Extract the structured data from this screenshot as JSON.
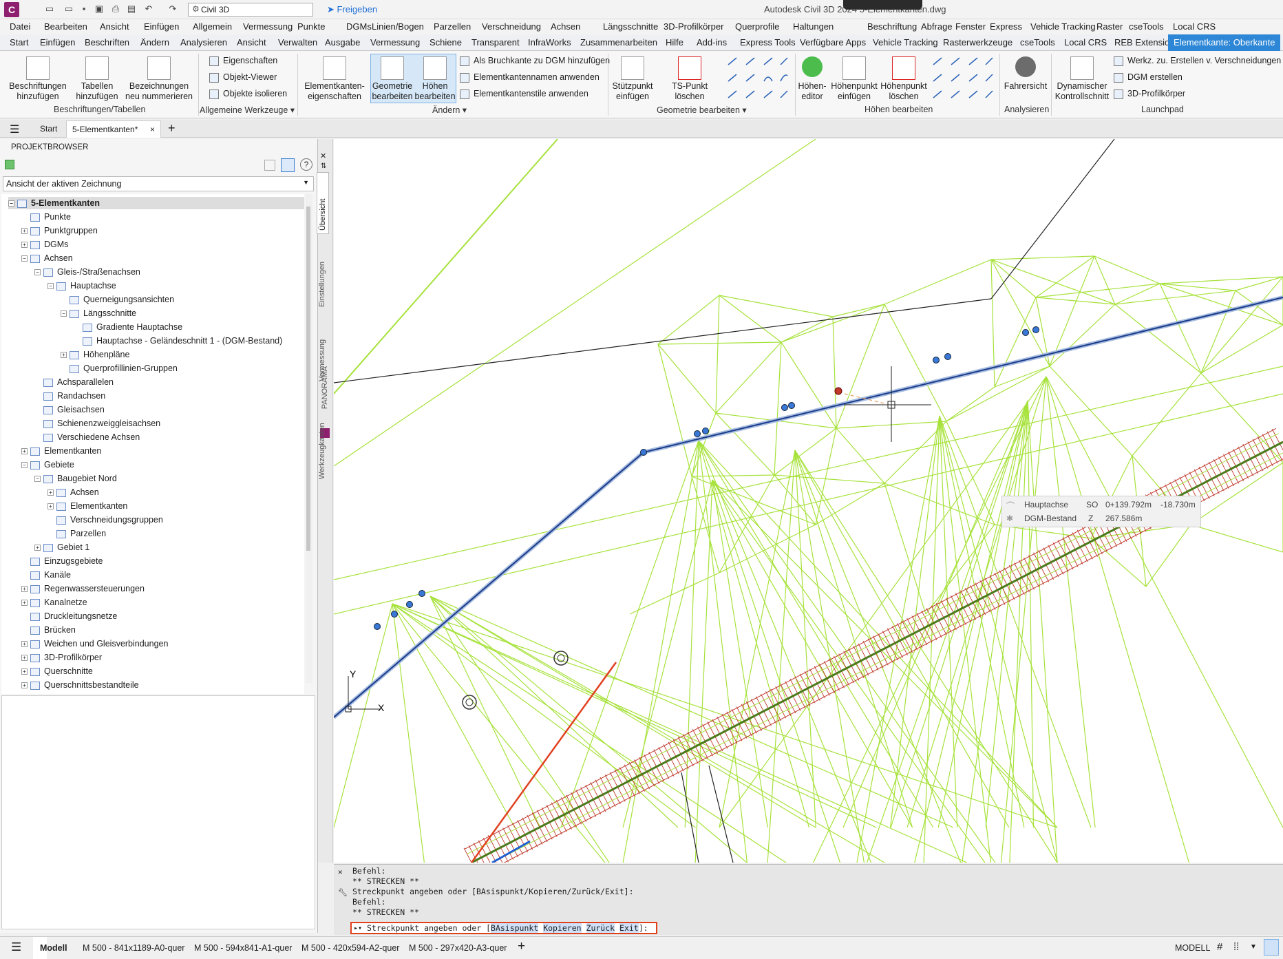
{
  "titlebar": {
    "workspace": "Civil 3D",
    "share": "Freigeben",
    "title": "Autodesk Civil 3D 2024    5-Elementkanten.dwg"
  },
  "menu": [
    "Datei",
    "Bearbeiten",
    "Ansicht",
    "Einfügen",
    "Allgemein",
    "Vermessung",
    "Punkte",
    "DGMs",
    "Linien/Bogen",
    "Parzellen",
    "Verschneidung",
    "Achsen",
    "Längsschnitte",
    "3D-Profilkörper",
    "Querprofile",
    "Haltungen",
    "Beschriftung",
    "Abfrage",
    "Fenster",
    "Express",
    "Vehicle Tracking",
    "Raster",
    "cseTools",
    "Local CRS"
  ],
  "ribbon_tabs": [
    "Start",
    "Einfügen",
    "Beschriften",
    "Ändern",
    "Analysieren",
    "Ansicht",
    "Verwalten",
    "Ausgabe",
    "Vermessung",
    "Schiene",
    "Transparent",
    "InfraWorks",
    "Zusammenarbeiten",
    "Hilfe",
    "Add-ins",
    "Express Tools",
    "Verfügbare Apps",
    "Vehicle Tracking",
    "Rasterwerkzeuge",
    "cseTools",
    "Local CRS",
    "REB Extension",
    "Elementkante: Oberkante"
  ],
  "ribbon": {
    "beschr1": "Beschriftungen",
    "beschr2": "hinzufügen",
    "tab1": "Tabellen",
    "tab2": "hinzufügen",
    "bez1": "Bezeichnungen",
    "bez2": "neu nummerieren",
    "panel1": "Beschriftungen/Tabellen",
    "eig": "Eigenschaften",
    "viewer": "Objekt-Viewer",
    "isol": "Objekte isolieren",
    "panel2": "Allgemeine Werkzeuge",
    "ek1": "Elementkanten-",
    "ek2": "eigenschaften",
    "geo1": "Geometrie",
    "geo2": "bearbeiten",
    "hoe1": "Höhen",
    "hoe2": "bearbeiten",
    "bruch": "Als Bruchkante zu DGM hinzufügen",
    "namen": "Elementkantennamen anwenden",
    "stile": "Elementkantenstile anwenden",
    "panel3": "Ändern",
    "stuetz1": "Stützpunkt",
    "stuetz2": "einfügen",
    "tsdel": "TS-Punkt löschen",
    "panel4": "Geometrie bearbeiten",
    "hed1": "Höhen-",
    "hed2": "editor",
    "hpe1": "Höhenpunkt",
    "hpe2": "einfügen",
    "hpl1": "Höhenpunkt",
    "hpl2": "löschen",
    "panel5": "Höhen bearbeiten",
    "fahr": "Fahrersicht",
    "panel6": "Analysieren",
    "dyn1": "Dynamischer",
    "dyn2": "Kontrollschnitt",
    "werkz": "Werkz. zu. Erstellen v. Verschneidungen",
    "dgm": "DGM erstellen",
    "pk": "3D-Profilkörper",
    "panel7": "Launchpad"
  },
  "filetabs": {
    "start": "Start",
    "doc": "5-Elementkanten*"
  },
  "browser": {
    "title": "PROJEKTBROWSER",
    "view": "Ansicht der aktiven Zeichnung",
    "tabs": [
      "Übersicht",
      "Einstellungen",
      "Vermessung",
      "Werkzeugkasten"
    ],
    "panorama": "PANORAMA",
    "tree": [
      {
        "label": "5-Elementkanten",
        "level": 0,
        "exp": "-"
      },
      {
        "label": "Punkte",
        "level": 1,
        "exp": ""
      },
      {
        "label": "Punktgruppen",
        "level": 1,
        "exp": "+"
      },
      {
        "label": "DGMs",
        "level": 1,
        "exp": "+"
      },
      {
        "label": "Achsen",
        "level": 1,
        "exp": "-"
      },
      {
        "label": "Gleis-/Straßenachsen",
        "level": 2,
        "exp": "-"
      },
      {
        "label": "Hauptachse",
        "level": 3,
        "exp": "-"
      },
      {
        "label": "Querneigungsansichten",
        "level": 4,
        "exp": ""
      },
      {
        "label": "Längsschnitte",
        "level": 4,
        "exp": "-"
      },
      {
        "label": "Gradiente Hauptachse",
        "level": 5,
        "exp": ""
      },
      {
        "label": "Hauptachse - Geländeschnitt 1 - (DGM-Bestand)",
        "level": 5,
        "exp": ""
      },
      {
        "label": "Höhenpläne",
        "level": 4,
        "exp": "+"
      },
      {
        "label": "Querprofillinien-Gruppen",
        "level": 4,
        "exp": ""
      },
      {
        "label": "Achsparallelen",
        "level": 2,
        "exp": ""
      },
      {
        "label": "Randachsen",
        "level": 2,
        "exp": ""
      },
      {
        "label": "Gleisachsen",
        "level": 2,
        "exp": ""
      },
      {
        "label": "Schienenzweiggleisachsen",
        "level": 2,
        "exp": ""
      },
      {
        "label": "Verschiedene Achsen",
        "level": 2,
        "exp": ""
      },
      {
        "label": "Elementkanten",
        "level": 1,
        "exp": "+"
      },
      {
        "label": "Gebiete",
        "level": 1,
        "exp": "-"
      },
      {
        "label": "Baugebiet Nord",
        "level": 2,
        "exp": "-"
      },
      {
        "label": "Achsen",
        "level": 3,
        "exp": "+"
      },
      {
        "label": "Elementkanten",
        "level": 3,
        "exp": "+"
      },
      {
        "label": "Verschneidungsgruppen",
        "level": 3,
        "exp": ""
      },
      {
        "label": "Parzellen",
        "level": 3,
        "exp": ""
      },
      {
        "label": "Gebiet 1",
        "level": 2,
        "exp": "+"
      },
      {
        "label": "Einzugsgebiete",
        "level": 1,
        "exp": ""
      },
      {
        "label": "Kanäle",
        "level": 1,
        "exp": ""
      },
      {
        "label": "Regenwassersteuerungen",
        "level": 1,
        "exp": "+"
      },
      {
        "label": "Kanalnetze",
        "level": 1,
        "exp": "+"
      },
      {
        "label": "Druckleitungsnetze",
        "level": 1,
        "exp": ""
      },
      {
        "label": "Brücken",
        "level": 1,
        "exp": ""
      },
      {
        "label": "Weichen und Gleisverbindungen",
        "level": 1,
        "exp": "+"
      },
      {
        "label": "3D-Profilkörper",
        "level": 1,
        "exp": "+"
      },
      {
        "label": "Querschnitte",
        "level": 1,
        "exp": "+"
      },
      {
        "label": "Querschnittsbestandteile",
        "level": 1,
        "exp": "+"
      }
    ]
  },
  "tooltip": {
    "r1a": "Hauptachse",
    "r1b": "SO",
    "r1c": "0+139.792m",
    "r1d": "-18.730m",
    "r2a": "DGM-Bestand",
    "r2b": "Z",
    "r2c": "267.586m"
  },
  "ucs": {
    "x": "X",
    "y": "Y"
  },
  "command": {
    "lines": [
      "Befehl:",
      "** STRECKEN **",
      "Streckpunkt angeben oder [BAsispunkt/Kopieren/Zurück/Exit]:",
      "Befehl:",
      "** STRECKEN **"
    ],
    "prompt": "Streckpunkt angeben oder [",
    "opt1": "BAsispunkt",
    "opt2": "Kopieren",
    "opt3": "Zurück",
    "opt4": "Exit",
    "end": "]:"
  },
  "status": {
    "modell": "Modell",
    "layouts": [
      "M 500 - 841x1189-A0-quer",
      "M 500 - 594x841-A1-quer",
      "M 500 - 420x594-A2-quer",
      "M 500 - 297x420-A3-quer"
    ],
    "mode": "MODELL"
  },
  "colors": {
    "accent": "#2d87d6",
    "tin": "#a6e23a",
    "alignment": "#1a3a8a",
    "cmd_border": "#e0401a"
  }
}
